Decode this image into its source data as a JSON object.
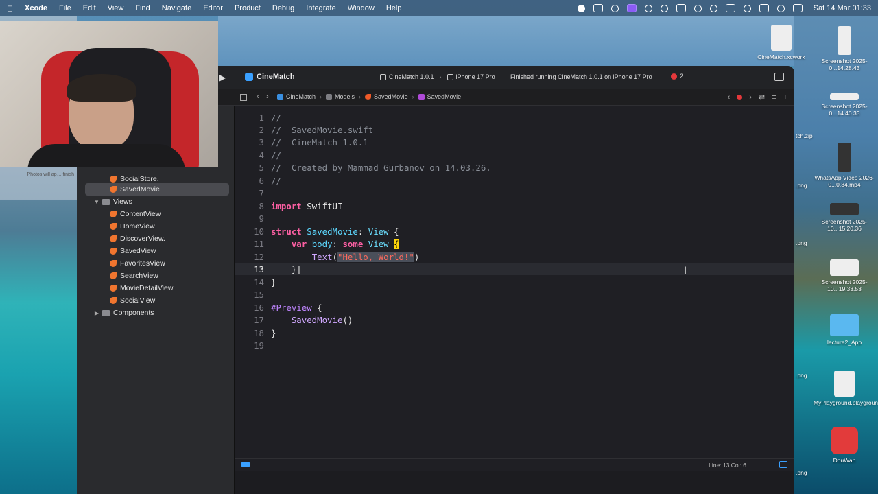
{
  "menubar": {
    "app": "Xcode",
    "items": [
      "File",
      "Edit",
      "View",
      "Find",
      "Navigate",
      "Editor",
      "Product",
      "Debug",
      "Integrate",
      "Window",
      "Help"
    ],
    "clock": "Sat 14 Mar  01:33"
  },
  "toolbar": {
    "project": "CineMatch",
    "scheme": "CineMatch 1.0.1",
    "device": "iPhone 17 Pro",
    "run_status": "Finished running CineMatch 1.0.1 on iPhone 17 Pro",
    "error_count": "2"
  },
  "jumpbar": {
    "crumbs": [
      "CineMatch",
      "Models",
      "SavedMovie",
      "SavedMovie"
    ]
  },
  "navigator": {
    "items": [
      {
        "label": "SocialStore.",
        "kind": "swift",
        "indent": 2
      },
      {
        "label": "SavedMovie",
        "kind": "swift",
        "indent": 2,
        "selected": true
      },
      {
        "label": "Views",
        "kind": "folder",
        "indent": 1,
        "expanded": true
      },
      {
        "label": "ContentView",
        "kind": "swift",
        "indent": 2
      },
      {
        "label": "HomeView",
        "kind": "swift",
        "indent": 2
      },
      {
        "label": "DiscoverView.",
        "kind": "swift",
        "indent": 2
      },
      {
        "label": "SavedView",
        "kind": "swift",
        "indent": 2
      },
      {
        "label": "FavoritesView",
        "kind": "swift",
        "indent": 2
      },
      {
        "label": "SearchView",
        "kind": "swift",
        "indent": 2
      },
      {
        "label": "MovieDetailView",
        "kind": "swift",
        "indent": 2
      },
      {
        "label": "SocialView",
        "kind": "swift",
        "indent": 2
      },
      {
        "label": "Components",
        "kind": "folder",
        "indent": 1,
        "expanded": false
      }
    ]
  },
  "editor": {
    "current_line": 13,
    "lines": [
      "//",
      "//  SavedMovie.swift",
      "//  CineMatch 1.0.1",
      "//",
      "//  Created by Mammad Gurbanov on 14.03.26.",
      "//",
      "",
      "import SwiftUI",
      "",
      "struct SavedMovie: View {",
      "    var body: some View {",
      "        Text(\"Hello, World!\")",
      "    }",
      "}",
      "",
      "#Preview {",
      "    SavedMovie()",
      "}",
      ""
    ]
  },
  "statusbar": {
    "position": "Line: 13  Col: 6"
  },
  "notification": {
    "text": "Photos will ap… finish"
  },
  "desktop": {
    "icons": [
      {
        "label": "CineMatch.xcwork",
        "name": "xcworkspace-file-icon"
      },
      {
        "label": "Screenshot 2025-0...14.28.43",
        "name": "screenshot-file-icon"
      },
      {
        "label": "Screenshot 2025-0...14.40.33",
        "name": "screenshot-file-icon"
      },
      {
        "label": "WhatsApp Video 2026-0...0.34.mp4",
        "name": "video-file-icon"
      },
      {
        "label": "Screenshot 2025-10...15.20.36",
        "name": "screenshot-file-icon"
      },
      {
        "label": "Screenshot 2025-10...19.33.53",
        "name": "screenshot-file-icon"
      },
      {
        "label": "lecture2_App",
        "name": "folder-icon"
      },
      {
        "label": "MyPlayground.playground",
        "name": "playground-file-icon"
      },
      {
        "label": "DouWan",
        "name": "app-icon"
      }
    ],
    "edge_labels": [
      "tch.zip",
      ".png",
      ".png",
      ".png",
      ".png",
      ".png"
    ]
  }
}
